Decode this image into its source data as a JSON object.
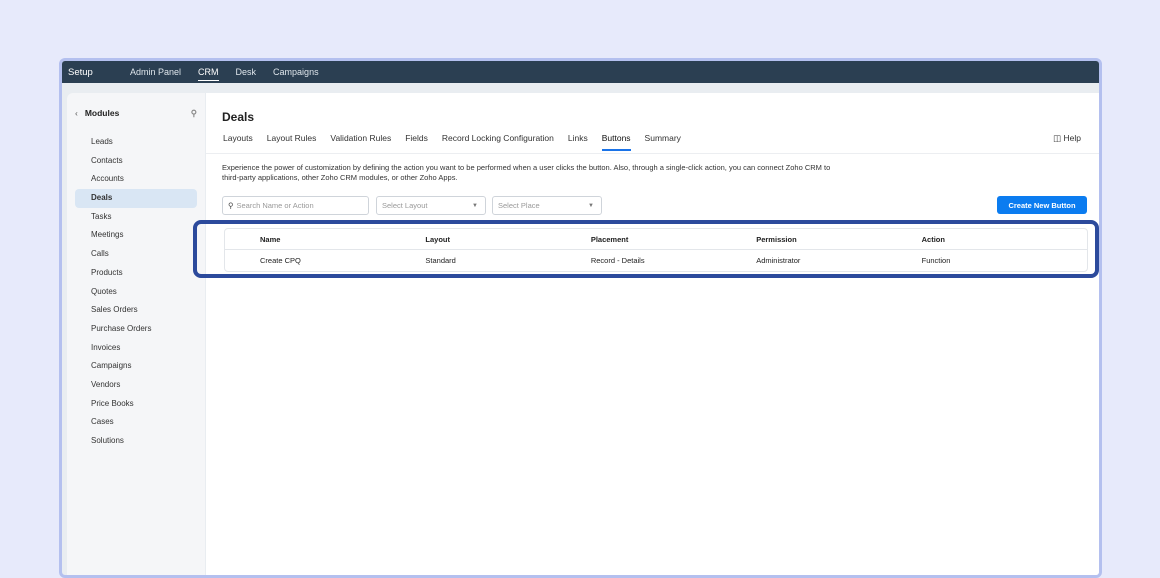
{
  "topbar": {
    "title": "Setup",
    "nav": [
      "Admin Panel",
      "CRM",
      "Desk",
      "Campaigns"
    ]
  },
  "sidebar": {
    "title": "Modules",
    "items": [
      "Leads",
      "Contacts",
      "Accounts",
      "Deals",
      "Tasks",
      "Meetings",
      "Calls",
      "Products",
      "Quotes",
      "Sales Orders",
      "Purchase Orders",
      "Invoices",
      "Campaigns",
      "Vendors",
      "Price Books",
      "Cases",
      "Solutions"
    ]
  },
  "main": {
    "title": "Deals",
    "tabs": [
      "Layouts",
      "Layout Rules",
      "Validation Rules",
      "Fields",
      "Record Locking Configuration",
      "Links",
      "Buttons",
      "Summary"
    ],
    "help": "Help",
    "description": "Experience the power of customization by defining the action you want to be performed when a user clicks the button. Also, through a single-click action, you can connect Zoho CRM to third-party applications, other Zoho CRM modules, or other Zoho Apps.",
    "search_placeholder": "Search Name or Action",
    "select_layout": "Select Layout",
    "select_place": "Select Place",
    "create_button": "Create New Button",
    "table": {
      "columns": [
        "Name",
        "Layout",
        "Placement",
        "Permission",
        "Action"
      ],
      "rows": [
        [
          "Create CPQ",
          "Standard",
          "Record - Details",
          "Administrator",
          "Function"
        ]
      ]
    }
  }
}
